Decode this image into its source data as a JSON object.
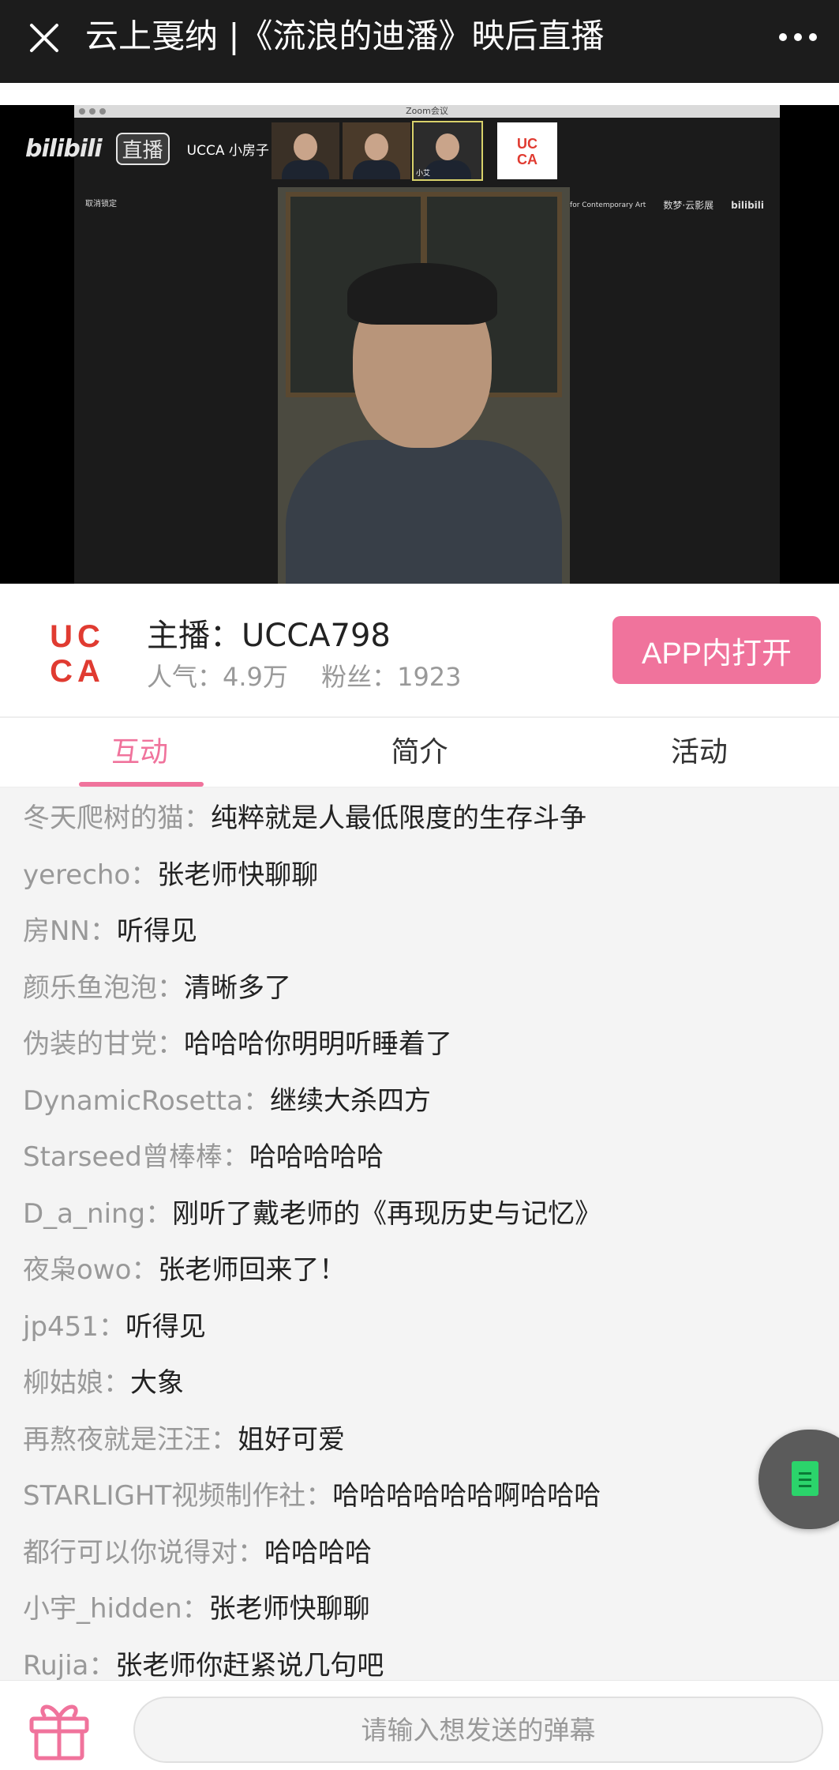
{
  "header": {
    "title": "云上戛纳 |《流浪的迪潘》映后直播",
    "close_icon": "close-icon",
    "more_icon": "more-dots-icon"
  },
  "video": {
    "platform_logo": "bilibili",
    "live_badge": "直播",
    "room_label": "UCCA 小房子",
    "zoom_title": "Zoom会议",
    "cancel_label": "取消锁定",
    "thumb_name": "小艾",
    "ucca_logo_lines": [
      "UC",
      "CA"
    ],
    "sponsor_ucca_text": "UCCA Center for Contemporary Art",
    "sponsor_2": "数梦·云影展",
    "sponsor_3": "bilibili"
  },
  "streamer": {
    "host": "主播：UCCA798",
    "popularity": "人气：4.9万",
    "fans": "粉丝：1923",
    "open_app_button": "APP内打开",
    "logo_lines": [
      "UC",
      "CA"
    ],
    "logo_color": "#e03b31"
  },
  "tabs": [
    {
      "label": "互动",
      "active": true
    },
    {
      "label": "简介",
      "active": false
    },
    {
      "label": "活动",
      "active": false
    }
  ],
  "chat": [
    {
      "user": "冬天爬树的猫：",
      "msg": "纯粹就是人最低限度的生存斗争"
    },
    {
      "user": "yerecho：",
      "msg": "张老师快聊聊"
    },
    {
      "user": "房NN：",
      "msg": "听得见"
    },
    {
      "user": "颜乐鱼泡泡：",
      "msg": "清晰多了"
    },
    {
      "user": "伪装的甘党：",
      "msg": "哈哈哈你明明听睡着了"
    },
    {
      "user": "DynamicRosetta：",
      "msg": "继续大杀四方"
    },
    {
      "user": "Starseed曾棒棒：",
      "msg": "哈哈哈哈哈"
    },
    {
      "user": "D_a_ning：",
      "msg": "刚听了戴老师的《再现历史与记忆》"
    },
    {
      "user": "夜枭owo：",
      "msg": "张老师回来了！"
    },
    {
      "user": "jp451：",
      "msg": "听得见"
    },
    {
      "user": "柳姑娘：",
      "msg": "大象"
    },
    {
      "user": "再熬夜就是汪汪：",
      "msg": "姐好可爱"
    },
    {
      "user": "STARLIGHT视频制作社：",
      "msg": "哈哈哈哈哈哈啊哈哈哈"
    },
    {
      "user": "都行可以你说得对：",
      "msg": "哈哈哈哈"
    },
    {
      "user": "小宇_hidden：",
      "msg": "张老师快聊聊"
    },
    {
      "user": "Rujia：",
      "msg": "张老师你赶紧说几句吧"
    }
  ],
  "bottom": {
    "gift_icon": "gift-icon",
    "input_placeholder": "请输入想发送的弹幕"
  },
  "colors": {
    "accent": "#f0739c",
    "topbar": "#1c1c1c",
    "chat_bg": "#f4f4f4"
  }
}
